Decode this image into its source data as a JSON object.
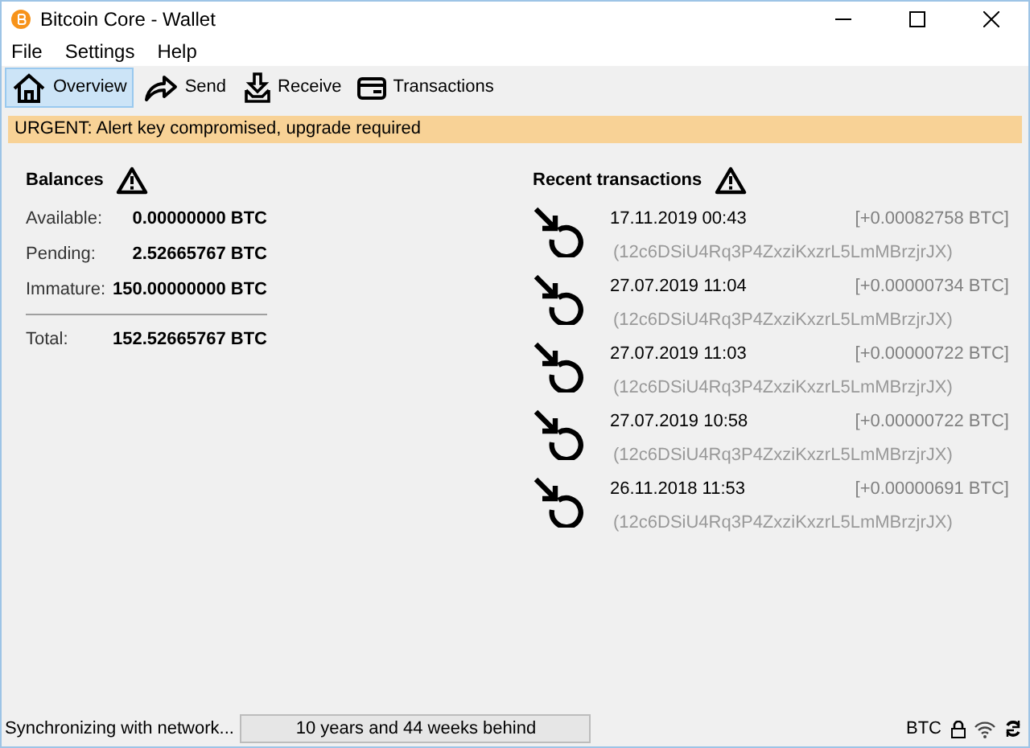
{
  "window": {
    "title": "Bitcoin Core - Wallet"
  },
  "menu": [
    "File",
    "Settings",
    "Help"
  ],
  "tabs": [
    {
      "label": "Overview",
      "kind": "home",
      "selected": true
    },
    {
      "label": "Send",
      "kind": "send",
      "selected": false
    },
    {
      "label": "Receive",
      "kind": "receive",
      "selected": false
    },
    {
      "label": "Transactions",
      "kind": "transactions",
      "selected": false
    }
  ],
  "alert": "URGENT: Alert key compromised, upgrade required",
  "balances": {
    "title": "Balances",
    "rows": [
      {
        "label": "Available:",
        "value": "0.00000000 BTC"
      },
      {
        "label": "Pending:",
        "value": "2.52665767 BTC"
      },
      {
        "label": "Immature:",
        "value": "150.00000000 BTC"
      }
    ],
    "total": {
      "label": "Total:",
      "value": "152.52665767 BTC"
    }
  },
  "recent": {
    "title": "Recent transactions",
    "items": [
      {
        "date": "17.11.2019 00:43",
        "address": "(12c6DSiU4Rq3P4ZxziKxzrL5LmMBrzjrJX)",
        "amount": "[+0.00082758 BTC]"
      },
      {
        "date": "27.07.2019 11:04",
        "address": "(12c6DSiU4Rq3P4ZxziKxzrL5LmMBrzjrJX)",
        "amount": "[+0.00000734 BTC]"
      },
      {
        "date": "27.07.2019 11:03",
        "address": "(12c6DSiU4Rq3P4ZxziKxzrL5LmMBrzjrJX)",
        "amount": "[+0.00000722 BTC]"
      },
      {
        "date": "27.07.2019 10:58",
        "address": "(12c6DSiU4Rq3P4ZxziKxzrL5LmMBrzjrJX)",
        "amount": "[+0.00000722 BTC]"
      },
      {
        "date": "26.11.2018 11:53",
        "address": "(12c6DSiU4Rq3P4ZxziKxzrL5LmMBrzjrJX)",
        "amount": "[+0.00000691 BTC]"
      }
    ]
  },
  "status": {
    "message": "Synchronizing with network...",
    "progress": "10 years and 44 weeks behind",
    "level": 0,
    "unit": "BTC"
  }
}
